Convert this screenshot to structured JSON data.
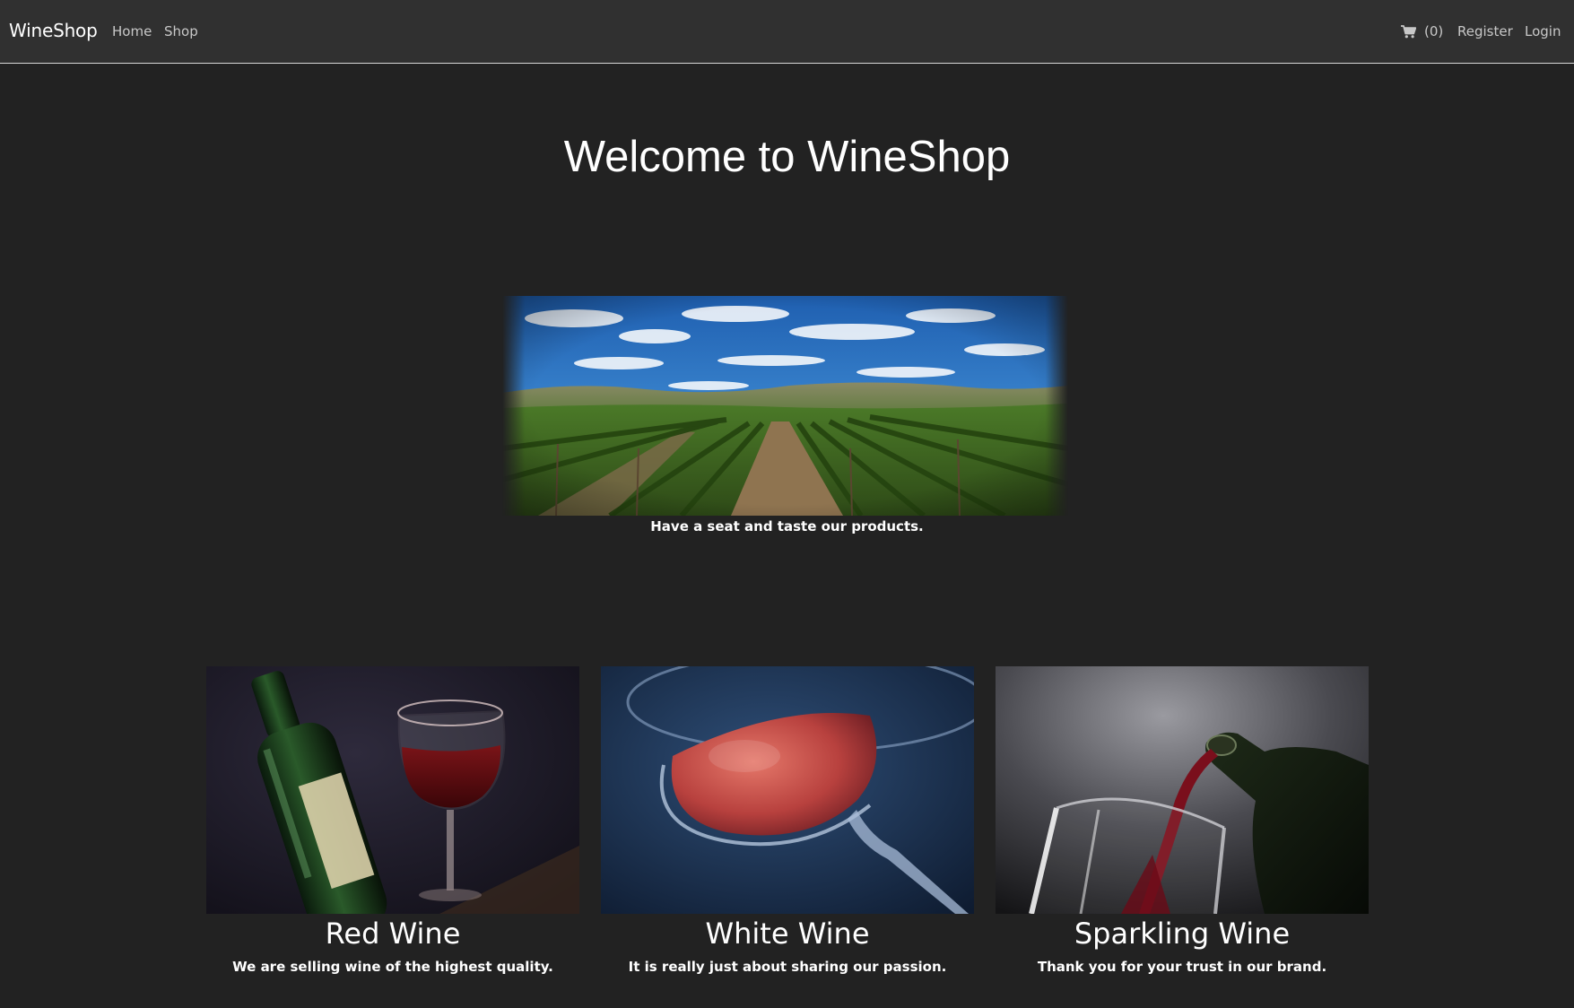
{
  "navbar": {
    "brand": "WineShop",
    "links": [
      {
        "label": "Home"
      },
      {
        "label": "Shop"
      }
    ],
    "cart_count": "(0)",
    "cart_icon": "shopping-cart-icon",
    "register_label": "Register",
    "login_label": "Login"
  },
  "hero": {
    "title": "Welcome to WineShop",
    "banner_caption": "Have a seat and taste our products."
  },
  "cards": [
    {
      "title": "Red Wine",
      "text": "We are selling wine of the highest quality."
    },
    {
      "title": "White Wine",
      "text": "It is really just about sharing our passion."
    },
    {
      "title": "Sparkling Wine",
      "text": "Thank you for your trust in our brand."
    }
  ],
  "colors": {
    "page_background": "#222222",
    "navbar_background": "#303030",
    "text": "#ffffff",
    "nav_link": "#c8c8c8"
  }
}
